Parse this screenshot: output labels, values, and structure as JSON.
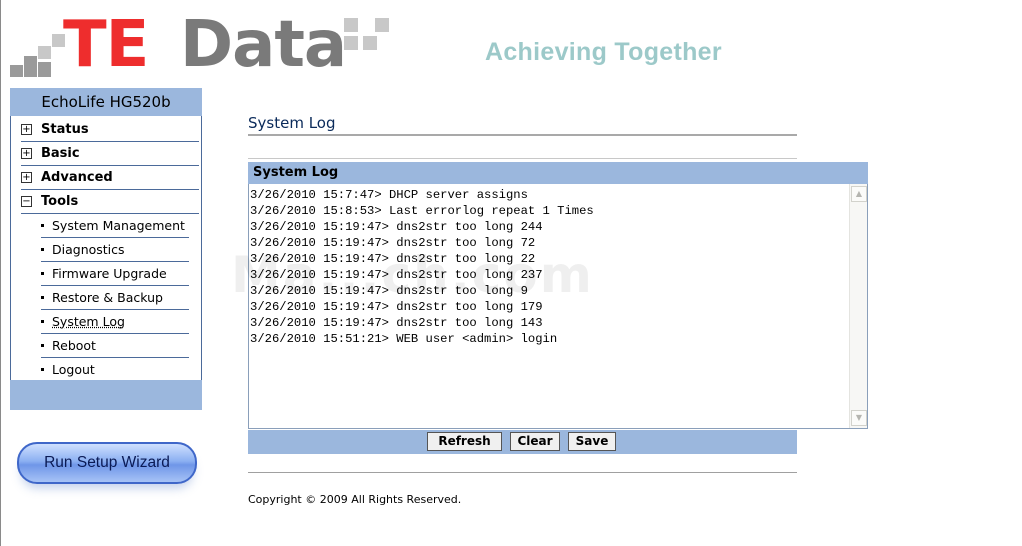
{
  "header": {
    "logo_te": "TE",
    "logo_data": "Data",
    "tagline": "Achieving Together"
  },
  "sidebar": {
    "model": "EchoLife HG520b",
    "menu": [
      {
        "label": "Status",
        "expanded": false,
        "icon": "plus-box-icon"
      },
      {
        "label": "Basic",
        "expanded": false,
        "icon": "plus-box-icon"
      },
      {
        "label": "Advanced",
        "expanded": false,
        "icon": "plus-box-icon"
      },
      {
        "label": "Tools",
        "expanded": true,
        "icon": "minus-box-icon"
      }
    ],
    "tools_items": [
      "System Management",
      "Diagnostics",
      "Firmware Upgrade",
      "Restore & Backup",
      "System Log",
      "Reboot",
      "Logout"
    ],
    "active_item": "System Log",
    "wizard_label": "Run Setup Wizard"
  },
  "main": {
    "page_title": "System Log",
    "panel_title": "System Log",
    "log_lines": [
      "3/26/2010 15:7:47> DHCP server assigns",
      "3/26/2010 15:8:53> Last errorlog repeat 1 Times",
      "3/26/2010 15:19:47> dns2str too long 244",
      "3/26/2010 15:19:47> dns2str too long 72",
      "3/26/2010 15:19:47> dns2str too long 22",
      "3/26/2010 15:19:47> dns2str too long 237",
      "3/26/2010 15:19:47> dns2str too long 9",
      "3/26/2010 15:19:47> dns2str too long 179",
      "3/26/2010 15:19:47> dns2str too long 143",
      "3/26/2010 15:51:21> WEB user <admin> login"
    ],
    "watermark": "Ma...ch.com",
    "buttons": {
      "refresh": "Refresh",
      "clear": "Clear",
      "save": "Save"
    },
    "copyright": "Copyright © 2009 All Rights Reserved."
  },
  "colors": {
    "accent_bar": "#9bb7dd",
    "logo_red": "#ee2d2d",
    "logo_gray": "#7a7a7a",
    "tagline": "#9cc9c9"
  }
}
